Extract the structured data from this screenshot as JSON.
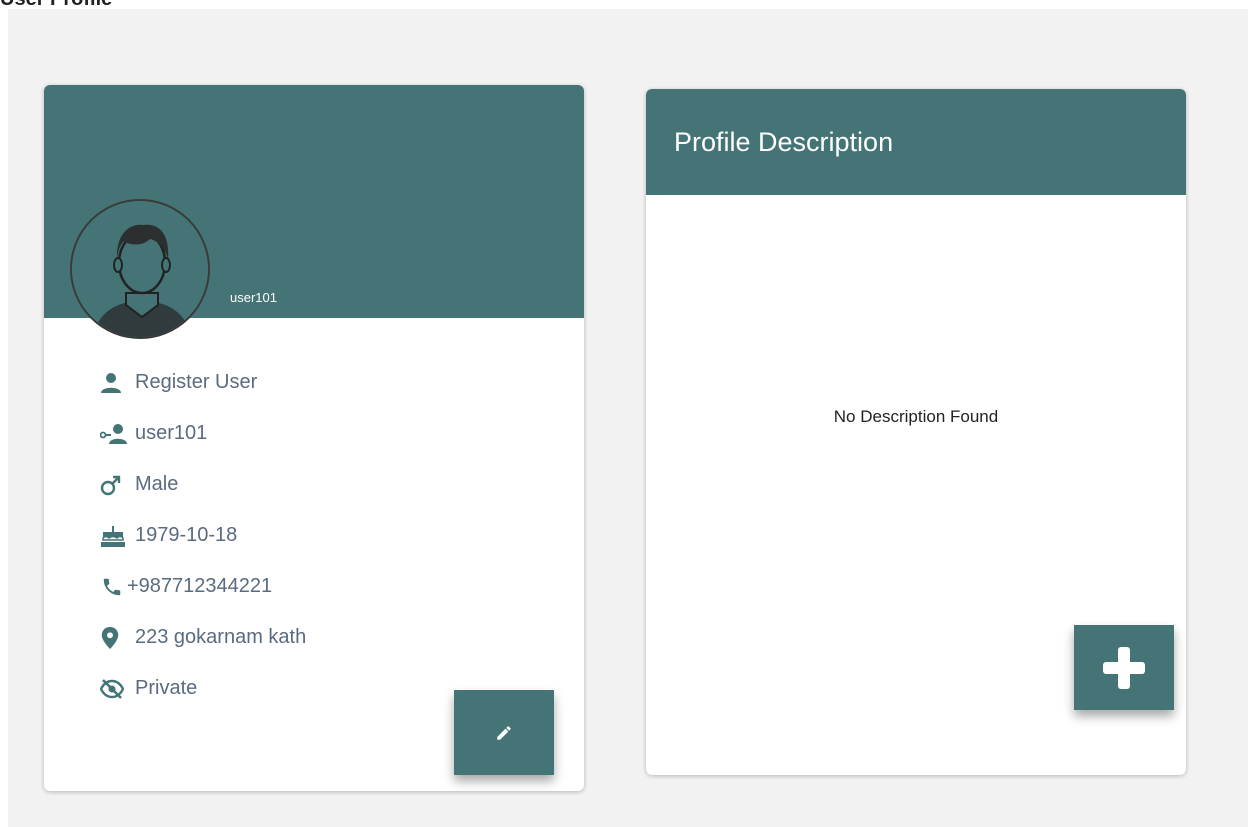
{
  "page": {
    "title": "User Profile"
  },
  "profile_card": {
    "username_tag": "user101",
    "items": [
      {
        "icon": "person-icon",
        "text": "Register User"
      },
      {
        "icon": "user-key-icon",
        "text": "user101"
      },
      {
        "icon": "male-icon",
        "text": "Male"
      },
      {
        "icon": "cake-icon",
        "text": "1979-10-18"
      },
      {
        "icon": "phone-icon",
        "text": "+987712344221"
      },
      {
        "icon": "location-pin-icon",
        "text": "223 gokarnam kath"
      },
      {
        "icon": "eye-off-icon",
        "text": "Private"
      }
    ],
    "edit_button_icon": "pencil-icon"
  },
  "description_card": {
    "title": "Profile Description",
    "empty_text": "No Description Found",
    "add_button_icon": "plus-icon"
  },
  "colors": {
    "accent": "#447475",
    "panel_bg": "#f2f2f2",
    "info_text": "#5a6b80"
  }
}
